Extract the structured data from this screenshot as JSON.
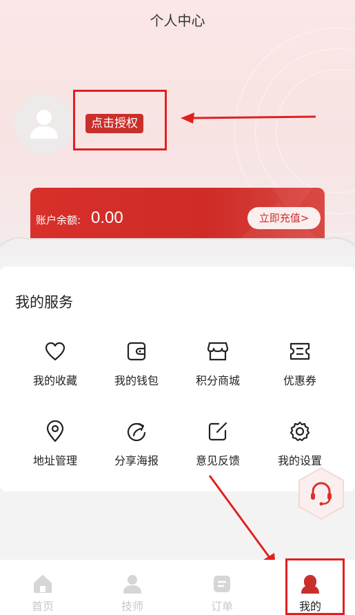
{
  "page": {
    "title": "个人中心"
  },
  "profile": {
    "auth_label": "点击授权"
  },
  "balance": {
    "label": "账户余额:",
    "amount": "0.00",
    "recharge_label": "立即充值>"
  },
  "services": {
    "title": "我的服务",
    "items": [
      {
        "label": "我的收藏",
        "icon": "heart-icon"
      },
      {
        "label": "我的钱包",
        "icon": "wallet-icon"
      },
      {
        "label": "积分商城",
        "icon": "store-icon"
      },
      {
        "label": "优惠券",
        "icon": "coupon-icon"
      },
      {
        "label": "地址管理",
        "icon": "location-pin-icon"
      },
      {
        "label": "分享海报",
        "icon": "share-icon"
      },
      {
        "label": "意见反馈",
        "icon": "edit-icon"
      },
      {
        "label": "我的设置",
        "icon": "gear-icon"
      }
    ]
  },
  "tabbar": {
    "items": [
      {
        "label": "首页",
        "icon": "home-icon"
      },
      {
        "label": "技师",
        "icon": "person-icon"
      },
      {
        "label": "订单",
        "icon": "order-icon"
      },
      {
        "label": "我的",
        "icon": "user-icon",
        "active": true
      }
    ]
  },
  "colors": {
    "accent": "#c9302c",
    "annotation": "#e02020"
  }
}
